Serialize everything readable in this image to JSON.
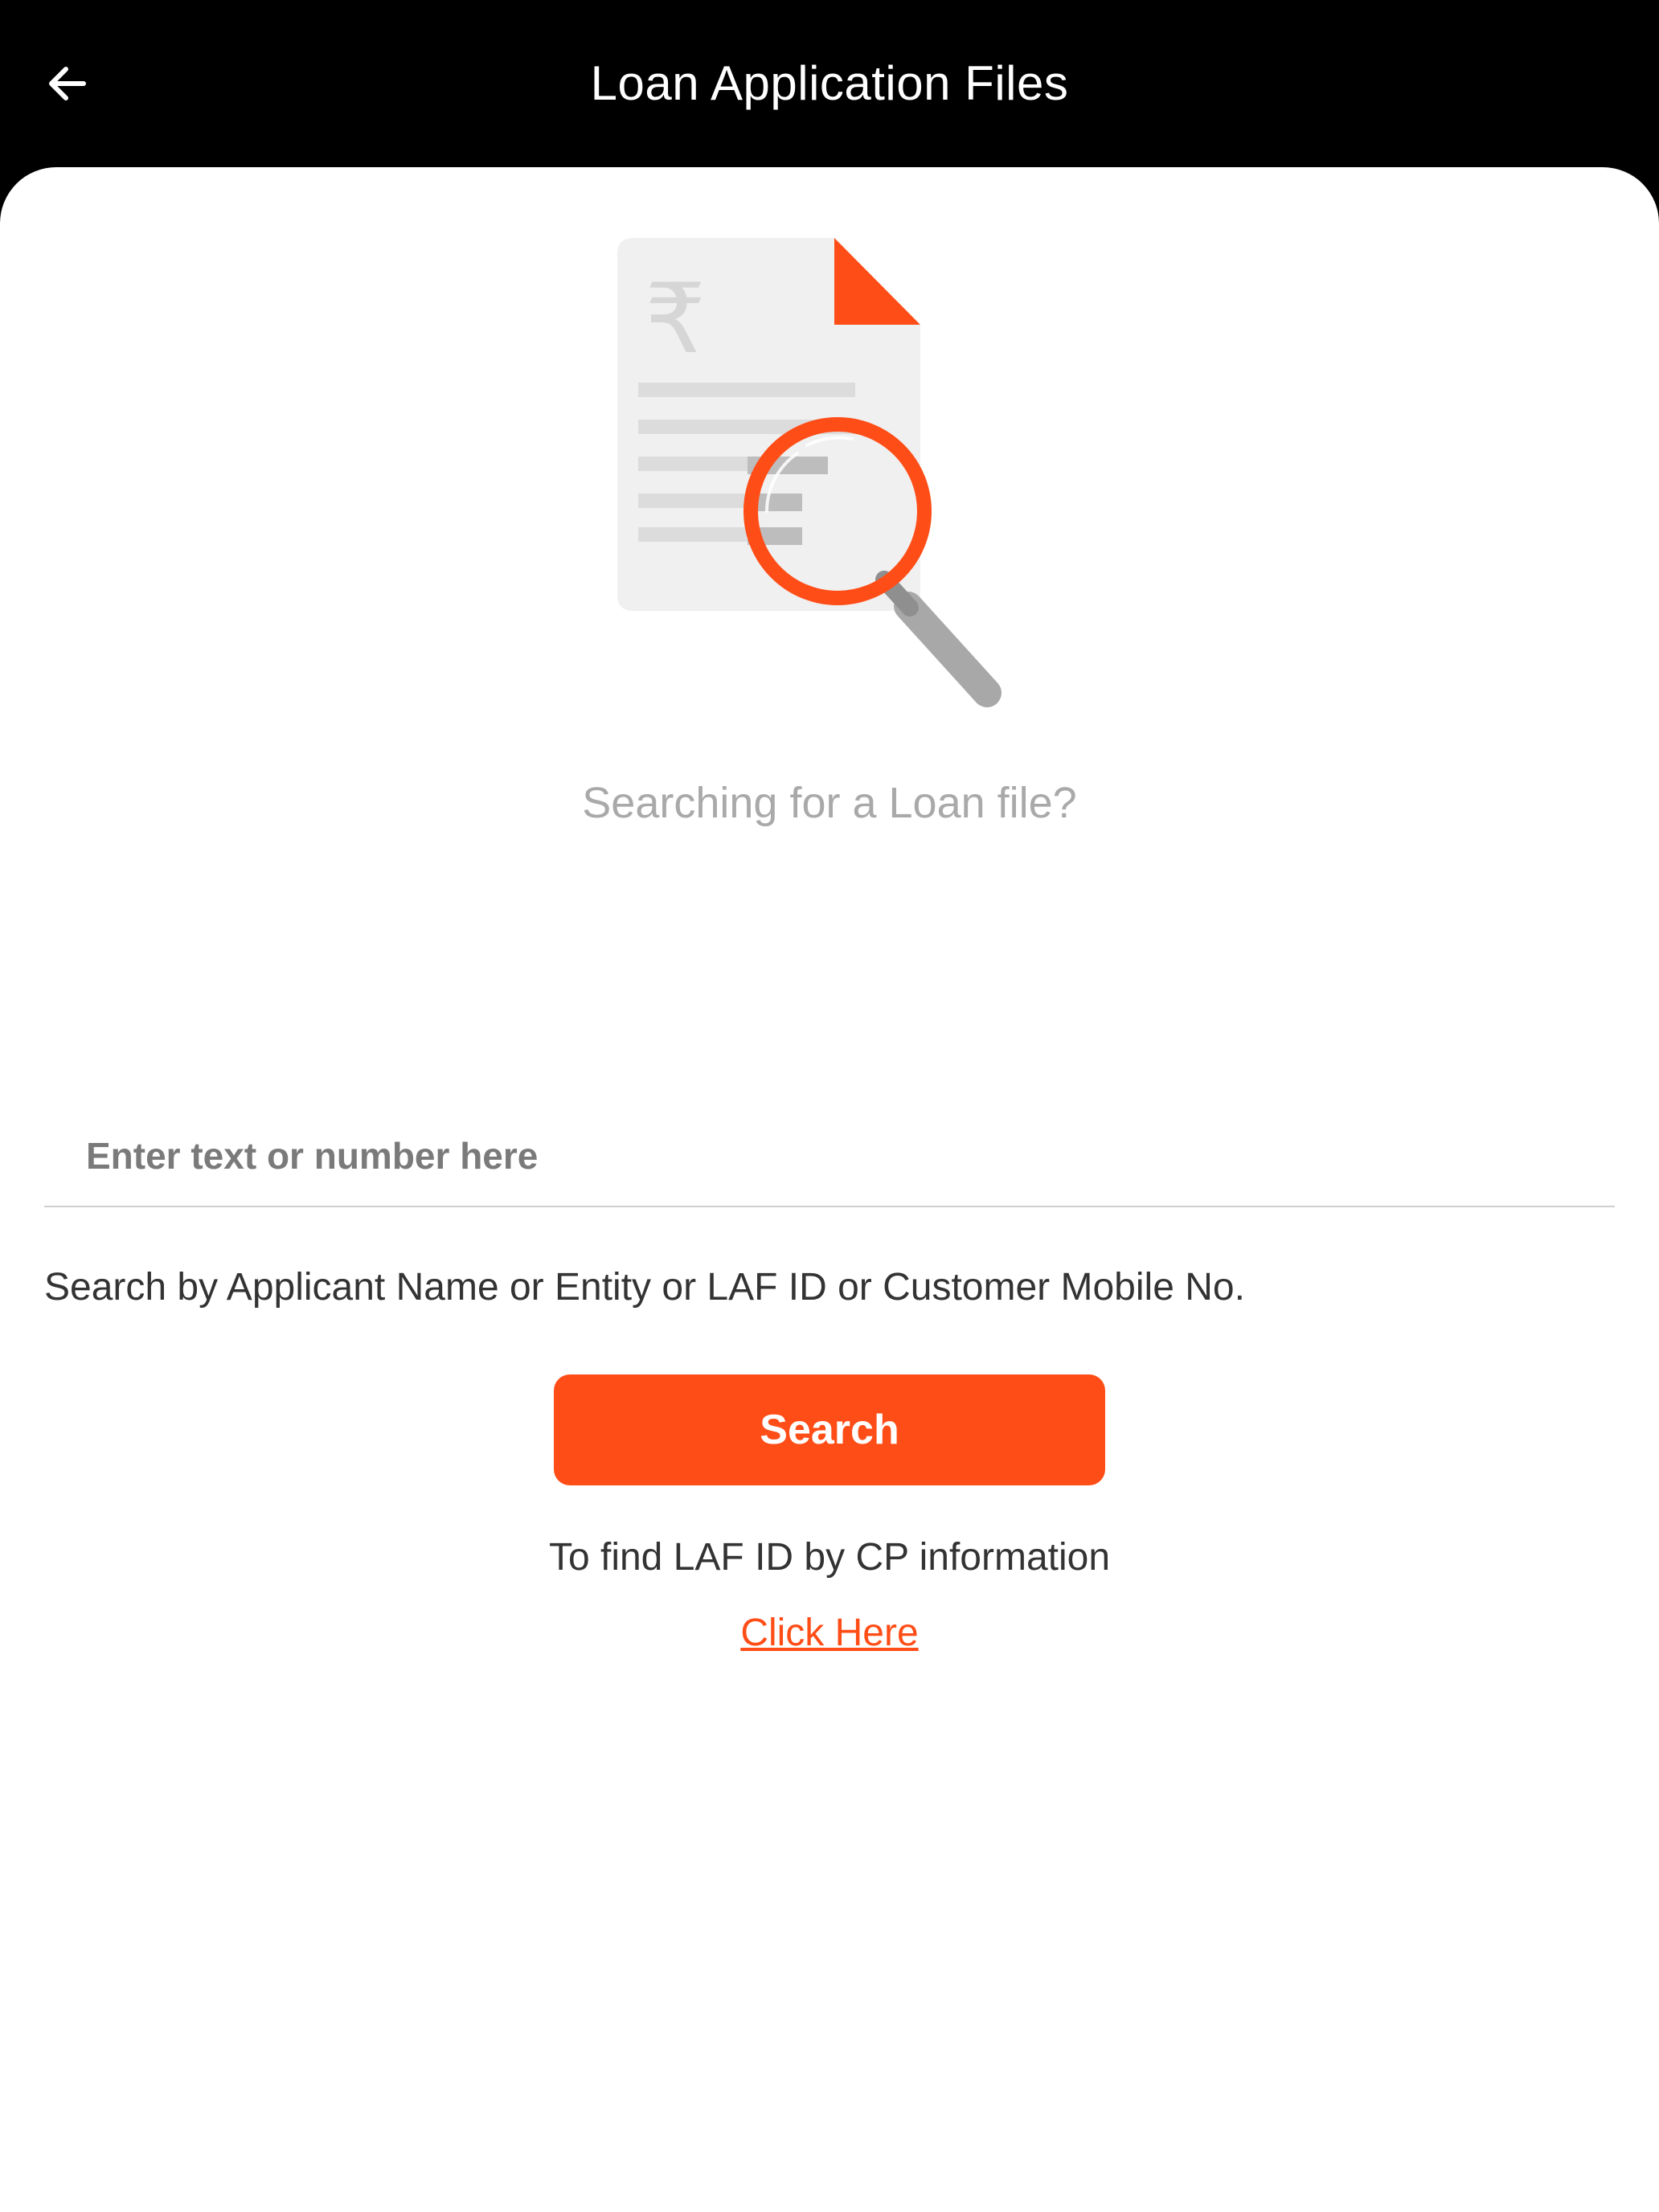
{
  "header": {
    "title": "Loan Application Files",
    "back_icon": "arrow-left-icon"
  },
  "empty_state": {
    "illustration_icon": "document-search-icon",
    "currency_symbol": "₹",
    "message": "Searching for a Loan file?"
  },
  "search": {
    "placeholder": "Enter text or number here",
    "value": "",
    "helper": "Search by Applicant Name or Entity or LAF ID or Customer Mobile No.",
    "button_label": "Search"
  },
  "cp_lookup": {
    "text": "To find LAF ID by CP information",
    "link_label": "Click Here"
  },
  "colors": {
    "accent": "#ff4d17",
    "header_bg": "#000000",
    "muted_text": "#a9a9a9",
    "body_text": "#333333"
  }
}
